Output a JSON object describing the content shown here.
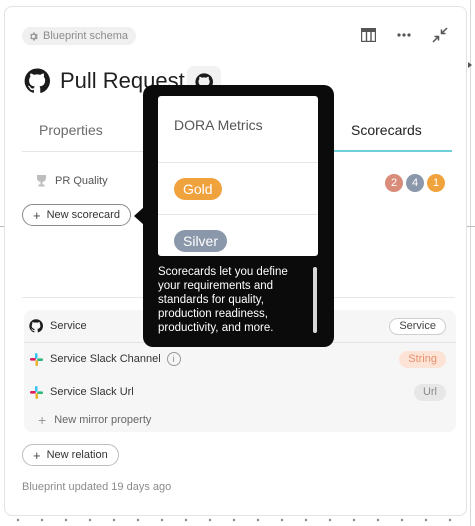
{
  "header": {
    "schema_chip": "Blueprint schema",
    "title": "Pull Request"
  },
  "tabs": [
    {
      "label": "Properties",
      "active": false
    },
    {
      "label": "Scorecards",
      "active": true
    }
  ],
  "scorecard": {
    "name": "PR Quality",
    "counts": [
      {
        "value": "2",
        "color": "#d98c7a"
      },
      {
        "value": "4",
        "color": "#8b97aa"
      },
      {
        "value": "1",
        "color": "#f0a23c"
      }
    ],
    "new_label": "New scorecard"
  },
  "tooltip": {
    "card_title": "DORA Metrics",
    "levels": [
      {
        "label": "Gold",
        "color": "#f0a23c"
      },
      {
        "label": "Silver",
        "color": "#8b97aa"
      }
    ],
    "description": "Scorecards let you define your requirements and standards for quality, production readiness, productivity, and more."
  },
  "relations": {
    "rows": [
      {
        "label": "Service",
        "type": "Service",
        "icon": "github-icon"
      },
      {
        "label": "Service Slack Channel",
        "type": "String",
        "icon": "slack-icon",
        "info": "i"
      },
      {
        "label": "Service Slack Url",
        "type": "Url",
        "icon": "slack-icon"
      }
    ],
    "new_mirror": "New mirror property"
  },
  "new_relation": "New relation",
  "footer": "Blueprint updated 19 days ago",
  "colors": {
    "accent_underline": "#6fd0d8",
    "gold": "#f0a23c",
    "silver": "#8b97aa",
    "string_badge_bg": "#fde3d6",
    "string_badge_text": "#e8906a"
  }
}
